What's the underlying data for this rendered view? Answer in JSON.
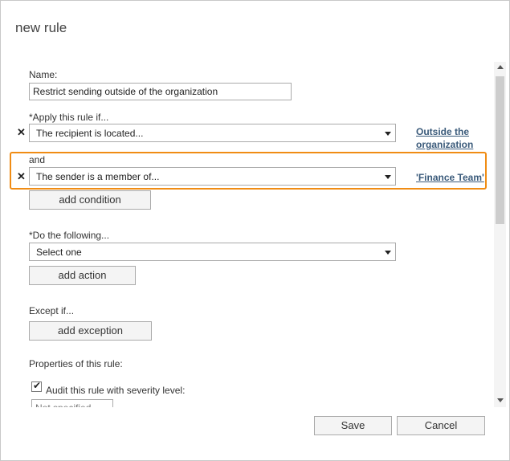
{
  "dialog": {
    "title": "new rule"
  },
  "name": {
    "label": "Name:",
    "value": "Restrict sending outside of the organization"
  },
  "apply": {
    "label": "*Apply this rule if...",
    "condition1": {
      "value": "The recipient is located...",
      "link_line1": "Outside the",
      "link_line2": "organization"
    },
    "and_label": "and",
    "condition2": {
      "value": "The sender is a member of...",
      "link": "'Finance Team'"
    },
    "add_condition": "add condition"
  },
  "do": {
    "label": "*Do the following...",
    "value": "Select one",
    "add_action": "add action"
  },
  "except": {
    "label": "Except if...",
    "add_exception": "add exception"
  },
  "properties": {
    "label": "Properties of this rule:",
    "audit_label": "Audit this rule with severity level:",
    "audit_checked": true,
    "severity_value": "Not specified"
  },
  "footer": {
    "save": "Save",
    "cancel": "Cancel"
  },
  "icons": {
    "remove": "close-icon",
    "dropdown": "chevron-down-icon"
  },
  "colors": {
    "highlight": "#f08c14",
    "link": "#3a5a7a"
  }
}
